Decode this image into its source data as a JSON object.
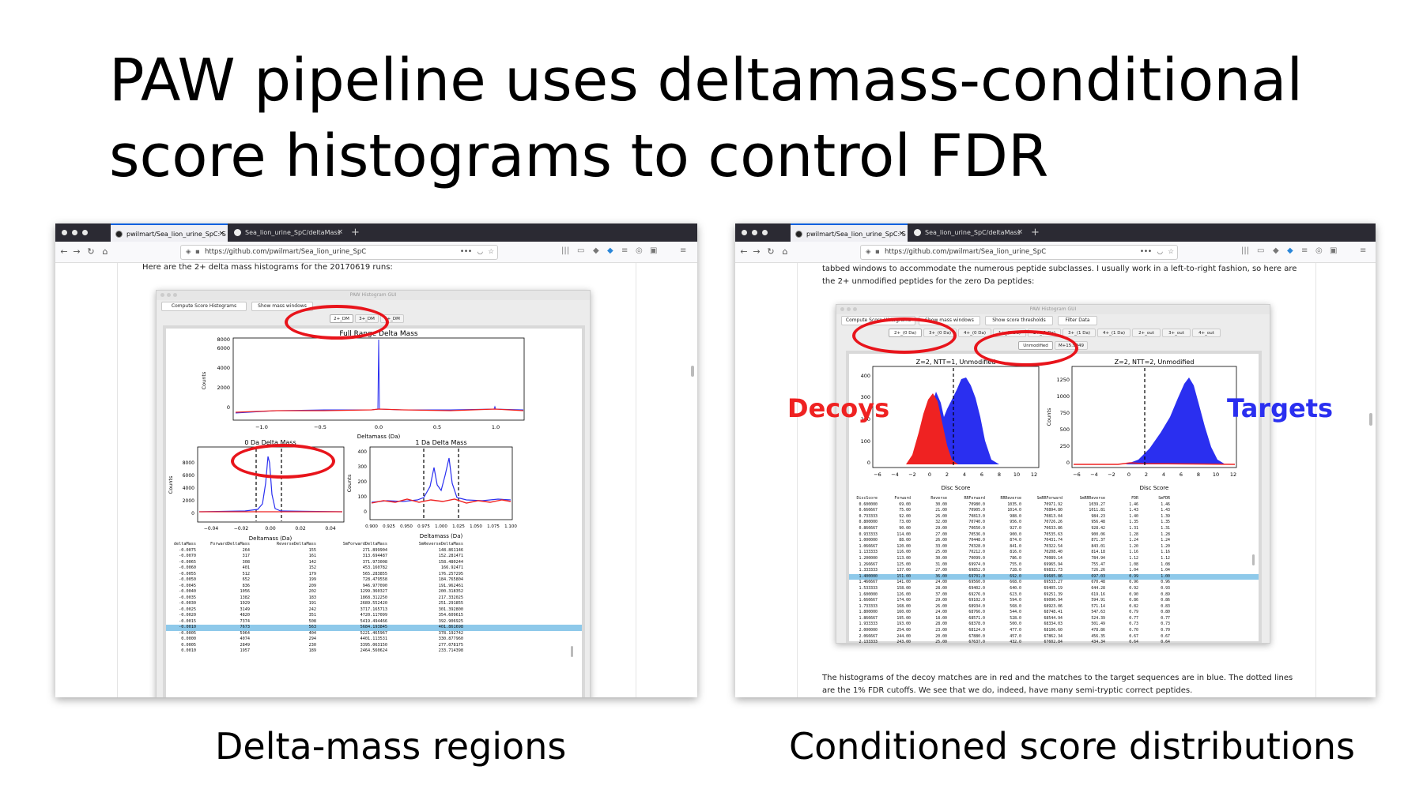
{
  "slide": {
    "title_line1": "PAW pipeline uses deltamass-conditional",
    "title_line2": "score histograms to control FDR",
    "caption_left": "Delta-mass regions",
    "caption_right": "Conditioned score distributions",
    "label_decoys": "Decoys",
    "label_targets": "Targets",
    "colors": {
      "decoy": "#ef2222",
      "target": "#2a2ff0",
      "highlight_ring": "#e8141b"
    }
  },
  "left_window": {
    "tabs": [
      {
        "label": "pwilmart/Sea_lion_urine_SpC: S"
      },
      {
        "label": "Sea_lion_urine_SpC/deltaMass"
      }
    ],
    "url": "https://github.com/pwilmart/Sea_lion_urine_SpC",
    "page_text": "Here are the 2+ delta mass histograms for the 20170619 runs:",
    "gui": {
      "title": "PAW Histogram GUI",
      "buttons": [
        "Compute Score Histograms",
        "Show mass windows"
      ],
      "tabs": [
        "2+_DM",
        "3+_DM",
        "4+_DM"
      ],
      "top_plot": {
        "title": "Full Range Delta Mass",
        "xlabel": "Deltamass (Da)",
        "ylabel": "Counts",
        "xticks": [
          "−1.0",
          "−0.5",
          "0.0",
          "0.5",
          "1.0"
        ],
        "yticks": [
          "0",
          "2000",
          "4000",
          "6000",
          "8000"
        ]
      },
      "mid_left_plot": {
        "title": "0 Da Delta Mass",
        "xlabel": "Deltamass (Da)",
        "ylabel": "Counts",
        "xticks": [
          "−0.04",
          "−0.02",
          "0.00",
          "0.02",
          "0.04"
        ],
        "yticks": [
          "0",
          "2000",
          "4000",
          "6000",
          "8000"
        ]
      },
      "mid_right_plot": {
        "title": "1 Da Delta Mass",
        "xlabel": "Deltamass (Da)",
        "ylabel": "Counts",
        "xticks": [
          "0.900",
          "0.925",
          "0.950",
          "0.975",
          "1.000",
          "1.025",
          "1.050",
          "1.075",
          "1.100"
        ],
        "yticks": [
          "0",
          "100",
          "200",
          "300",
          "400"
        ]
      },
      "table": {
        "headers": [
          "deltaMass",
          "ForwardDeltaMass",
          "ReverseDeltaMass",
          "SmForwardDeltaMass",
          "SmReverseDeltaMass"
        ],
        "rows": [
          [
            "-0.0075",
            "264",
            "155",
            "271.899904",
            "148.861146"
          ],
          [
            "-0.0070",
            "317",
            "161",
            "313.694487",
            "152.281471"
          ],
          [
            "-0.0065",
            "308",
            "142",
            "371.973008",
            "158.480244"
          ],
          [
            "-0.0060",
            "401",
            "152",
            "453.160782",
            "166.92471"
          ],
          [
            "-0.0055",
            "512",
            "179",
            "565.283855",
            "176.257295"
          ],
          [
            "-0.0050",
            "652",
            "199",
            "728.479558",
            "184.765804"
          ],
          [
            "-0.0045",
            "836",
            "209",
            "946.977090",
            "191.962461"
          ],
          [
            "-0.0040",
            "1056",
            "202",
            "1299.360327",
            "200.318352"
          ],
          [
            "-0.0035",
            "1382",
            "183",
            "1868.312250",
            "217.332025"
          ],
          [
            "-0.0030",
            "1929",
            "191",
            "2689.552420",
            "251.291855"
          ],
          [
            "-0.0025",
            "3149",
            "242",
            "3717.165713",
            "301.392800"
          ],
          [
            "-0.0020",
            "4820",
            "351",
            "4720.117099",
            "354.609615"
          ],
          [
            "-0.0015",
            "7374",
            "508",
            "5419.494466",
            "392.906925"
          ],
          [
            "-0.0010",
            "7673",
            "563",
            "5684.193845",
            "401.861698"
          ],
          [
            "-0.0005",
            "5964",
            "404",
            "5221.465967",
            "378.192742"
          ],
          [
            "0.0000",
            "4074",
            "294",
            "4401.113531",
            "330.877960"
          ],
          [
            "0.0005",
            "2849",
            "230",
            "3395.063150",
            "277.078175"
          ],
          [
            "0.0010",
            "1957",
            "189",
            "2464.560624",
            "233.714398"
          ]
        ],
        "highlighted_row": 13
      }
    }
  },
  "right_window": {
    "tabs": [
      {
        "label": "pwilmart/Sea_lion_urine_SpC: S"
      },
      {
        "label": "Sea_lion_urine_SpC/deltaMass"
      }
    ],
    "url": "https://github.com/pwilmart/Sea_lion_urine_SpC",
    "page_text_line1": "tabbed windows to accommodate the numerous peptide subclasses. I usually work in a left-to-right fashion, so here are",
    "page_text_line2": "the 2+ unmodified peptides for the zero Da peptides:",
    "page_text_bottom_line1": "The histograms of the decoy matches are in red and the matches to the target sequences are in blue. The dotted lines",
    "page_text_bottom_line2": "are the 1% FDR cutoffs. We see that we do, indeed, have many semi-tryptic correct peptides.",
    "gui": {
      "title": "PAW Histogram GUI",
      "buttons": [
        "Compute Score Histograms",
        "Show mass windows",
        "Show score thresholds",
        "Filter Data"
      ],
      "tabs": [
        "2+_(0 Da)",
        "3+_(0 Da)",
        "4+_(0 Da)",
        "1+_(1 Da)",
        "2+_(1 Da)",
        "3+_(1 Da)",
        "4+_(1 Da)",
        "2+_out",
        "3+_out",
        "4+_out"
      ],
      "subtabs": [
        "Unmodified",
        "M+15.9949"
      ],
      "left_plot": {
        "title": "Z=2, NTT=1, Unmodified",
        "xlabel": "Disc Score",
        "ylabel": "Counts",
        "xticks": [
          "−6",
          "−4",
          "−2",
          "0",
          "2",
          "4",
          "6",
          "8",
          "10",
          "12"
        ],
        "yticks": [
          "0",
          "100",
          "200",
          "300",
          "400"
        ]
      },
      "right_plot": {
        "title": "Z=2, NTT=2, Unmodified",
        "xlabel": "Disc Score",
        "ylabel": "Counts",
        "xticks": [
          "−6",
          "−4",
          "−2",
          "0",
          "2",
          "4",
          "6",
          "8",
          "10",
          "12"
        ],
        "yticks": [
          "0",
          "250",
          "500",
          "750",
          "1000",
          "1250"
        ]
      },
      "table": {
        "headers": [
          "DiscScore",
          "Forward",
          "Reverse",
          "RRForward",
          "RRReverse",
          "SmRRForward",
          "SmRRReverse",
          "FDR",
          "SmFDR"
        ],
        "rows": [
          [
            "0.600000",
            "69.00",
            "30.00",
            "70980.0",
            "1035.0",
            "70971.92",
            "1039.27",
            "1.46",
            "1.46"
          ],
          [
            "0.666667",
            "75.00",
            "21.00",
            "70905.0",
            "1014.0",
            "70894.80",
            "1011.81",
            "1.43",
            "1.43"
          ],
          [
            "0.733333",
            "92.00",
            "26.00",
            "70813.0",
            "988.0",
            "70813.04",
            "984.23",
            "1.40",
            "1.39"
          ],
          [
            "0.800000",
            "73.00",
            "32.00",
            "70740.0",
            "956.0",
            "70726.26",
            "956.48",
            "1.35",
            "1.35"
          ],
          [
            "0.866667",
            "90.00",
            "29.00",
            "70650.0",
            "927.0",
            "70633.86",
            "928.42",
            "1.31",
            "1.31"
          ],
          [
            "0.933333",
            "114.00",
            "27.00",
            "70536.0",
            "900.0",
            "70535.63",
            "900.06",
            "1.28",
            "1.28"
          ],
          [
            "1.000000",
            "88.00",
            "26.00",
            "70448.0",
            "874.0",
            "70431.74",
            "871.37",
            "1.24",
            "1.24"
          ],
          [
            "1.066667",
            "120.00",
            "33.00",
            "70328.0",
            "841.0",
            "70322.54",
            "843.01",
            "1.20",
            "1.20"
          ],
          [
            "1.133333",
            "116.00",
            "25.00",
            "70212.0",
            "816.0",
            "70208.40",
            "814.18",
            "1.16",
            "1.16"
          ],
          [
            "1.200000",
            "113.00",
            "30.00",
            "70099.0",
            "786.0",
            "70089.14",
            "784.94",
            "1.12",
            "1.12"
          ],
          [
            "1.266667",
            "125.00",
            "31.00",
            "69974.0",
            "755.0",
            "69965.94",
            "755.47",
            "1.08",
            "1.08"
          ],
          [
            "1.333333",
            "137.00",
            "27.00",
            "69852.0",
            "728.0",
            "69832.73",
            "726.26",
            "1.04",
            "1.04"
          ],
          [
            "1.400000",
            "151.00",
            "36.00",
            "69701.0",
            "692.0",
            "69685.86",
            "697.03",
            "0.99",
            "1.00"
          ],
          [
            "1.466667",
            "141.00",
            "24.00",
            "69560.0",
            "668.0",
            "69533.27",
            "670.48",
            "0.96",
            "0.96"
          ],
          [
            "1.533333",
            "158.00",
            "28.00",
            "69402.0",
            "640.0",
            "69405.19",
            "644.28",
            "0.92",
            "0.93"
          ],
          [
            "1.600000",
            "126.00",
            "37.00",
            "69276.0",
            "623.0",
            "69251.39",
            "619.16",
            "0.90",
            "0.89"
          ],
          [
            "1.666667",
            "174.00",
            "29.00",
            "69102.0",
            "594.0",
            "69090.94",
            "594.91",
            "0.86",
            "0.86"
          ],
          [
            "1.733333",
            "168.00",
            "26.00",
            "68934.0",
            "568.0",
            "68923.06",
            "571.14",
            "0.82",
            "0.83"
          ],
          [
            "1.800000",
            "160.00",
            "24.00",
            "68766.0",
            "544.0",
            "68748.41",
            "547.63",
            "0.79",
            "0.80"
          ],
          [
            "1.866667",
            "195.00",
            "18.00",
            "68571.0",
            "528.0",
            "68544.94",
            "524.39",
            "0.77",
            "0.77"
          ],
          [
            "1.933333",
            "193.00",
            "28.00",
            "68378.0",
            "500.0",
            "68334.03",
            "501.49",
            "0.73",
            "0.73"
          ],
          [
            "2.000000",
            "254.00",
            "23.00",
            "68124.0",
            "477.0",
            "68106.60",
            "478.86",
            "0.70",
            "0.70"
          ],
          [
            "2.066667",
            "244.00",
            "20.00",
            "67880.0",
            "457.0",
            "67862.34",
            "456.35",
            "0.67",
            "0.67"
          ],
          [
            "2.133333",
            "243.00",
            "25.00",
            "67637.0",
            "432.0",
            "67602.84",
            "434.34",
            "0.64",
            "0.64"
          ]
        ],
        "highlighted_row": 12
      }
    }
  }
}
